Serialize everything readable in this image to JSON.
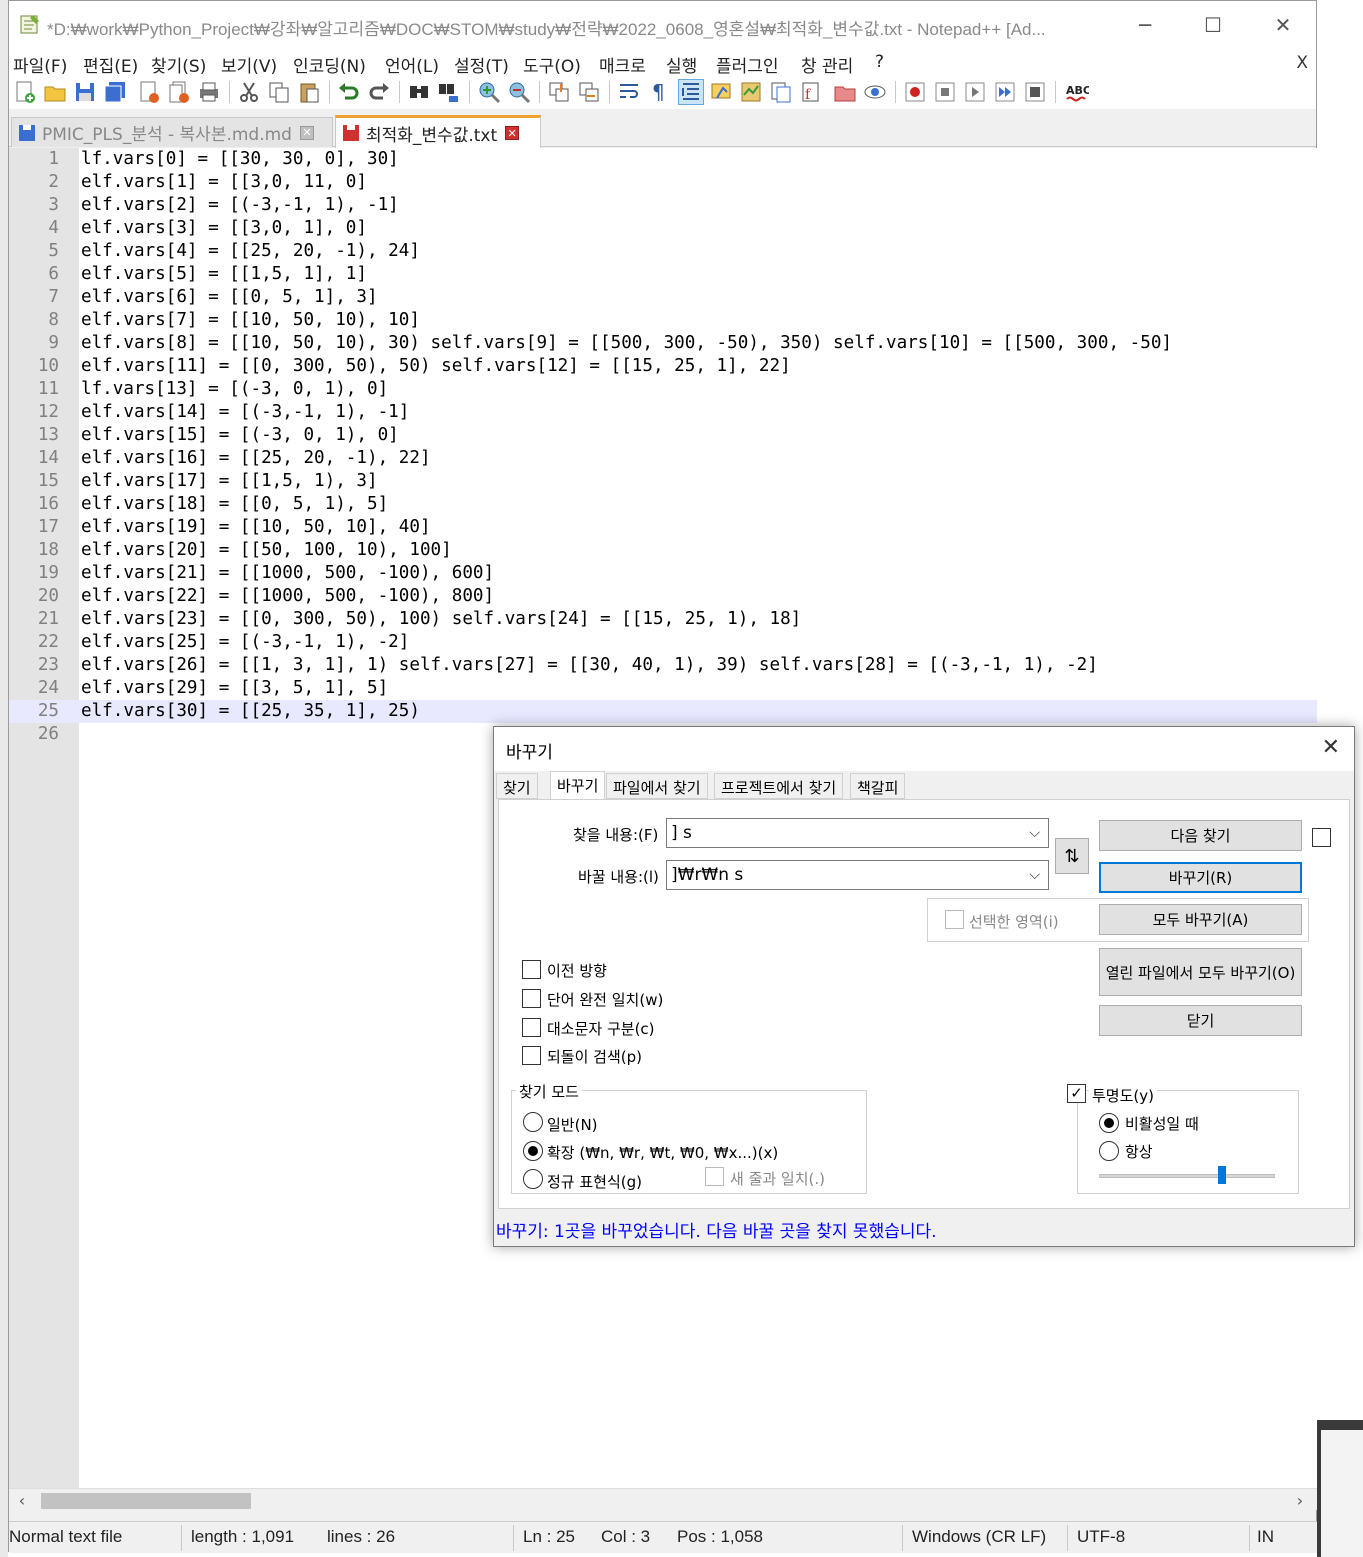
{
  "window": {
    "title": "*D:₩work₩Python_Project₩강좌₩알고리즘₩DOC₩STOM₩study₩전략₩2022_0608_영혼설₩최적화_변수값.txt - Notepad++ [Ad...",
    "minimize": "─",
    "maximize": "☐",
    "close": "✕"
  },
  "menu": {
    "items": [
      "파일(F)",
      "편집(E)",
      "찾기(S)",
      "보기(V)",
      "인코딩(N)",
      "언어(L)",
      "설정(T)",
      "도구(O)",
      "매크로",
      "실행",
      "플러그인",
      "창 관리",
      "?"
    ],
    "close": "X"
  },
  "tabs": [
    {
      "label": "PMIC_PLS_분석 - 복사본.md.md",
      "close": "✕"
    },
    {
      "label": "최적화_변수값.txt",
      "close": "✕"
    }
  ],
  "editor": {
    "lines": [
      {
        "n": "1",
        "text": "lf.vars[0] = [[30, 30, 0], 30]"
      },
      {
        "n": "2",
        "text": "elf.vars[1] = [[3,0, 11, 0]"
      },
      {
        "n": "3",
        "text": "elf.vars[2] = [(-3,-1, 1), -1]"
      },
      {
        "n": "4",
        "text": "elf.vars[3] = [[3,0, 1], 0]"
      },
      {
        "n": "5",
        "text": "elf.vars[4] = [[25, 20, -1), 24]"
      },
      {
        "n": "6",
        "text": "elf.vars[5] = [[1,5, 1], 1]"
      },
      {
        "n": "7",
        "text": "elf.vars[6] = [[0, 5, 1], 3]"
      },
      {
        "n": "8",
        "text": "elf.vars[7] = [[10, 50, 10), 10]"
      },
      {
        "n": "9",
        "text": "elf.vars[8] = [[10, 50, 10), 30) self.vars[9] = [[500, 300, -50), 350) self.vars[10] = [[500, 300, -50]"
      },
      {
        "n": "10",
        "text": "elf.vars[11] = [[0, 300, 50), 50) self.vars[12] = [[15, 25, 1], 22]"
      },
      {
        "n": "11",
        "text": "lf.vars[13] = [(-3, 0, 1), 0]"
      },
      {
        "n": "12",
        "text": "elf.vars[14] = [(-3,-1, 1), -1]"
      },
      {
        "n": "13",
        "text": "elf.vars[15] = [(-3, 0, 1), 0]"
      },
      {
        "n": "14",
        "text": "elf.vars[16] = [[25, 20, -1), 22]"
      },
      {
        "n": "15",
        "text": "elf.vars[17] = [[1,5, 1), 3]"
      },
      {
        "n": "16",
        "text": "elf.vars[18] = [[0, 5, 1), 5]"
      },
      {
        "n": "17",
        "text": "elf.vars[19] = [[10, 50, 10], 40]"
      },
      {
        "n": "18",
        "text": "elf.vars[20] = [[50, 100, 10), 100]"
      },
      {
        "n": "19",
        "text": "elf.vars[21] = [[1000, 500, -100), 600]"
      },
      {
        "n": "20",
        "text": "elf.vars[22] = [[1000, 500, -100), 800]"
      },
      {
        "n": "21",
        "text": "elf.vars[23] = [[0, 300, 50), 100) self.vars[24] = [[15, 25, 1), 18]"
      },
      {
        "n": "22",
        "text": "elf.vars[25] = [(-3,-1, 1), -2]"
      },
      {
        "n": "23",
        "text": "elf.vars[26] = [[1, 3, 1], 1) self.vars[27] = [[30, 40, 1), 39) self.vars[28] = [(-3,-1, 1), -2]"
      },
      {
        "n": "24",
        "text": "elf.vars[29] = [[3, 5, 1], 5]"
      },
      {
        "n": "25",
        "text": "elf.vars[30] = [[25, 35, 1], 25)"
      },
      {
        "n": "26",
        "text": ""
      }
    ],
    "current_line": "25"
  },
  "scroll": {
    "left": "‹",
    "right": "›"
  },
  "status": {
    "filetype": "Normal text file",
    "length": "length : 1,091",
    "lines": "lines : 26",
    "ln": "Ln : 25",
    "col": "Col : 3",
    "pos": "Pos : 1,058",
    "eol": "Windows (CR LF)",
    "encoding": "UTF-8",
    "mode": "IN"
  },
  "dialog": {
    "title": "바꾸기",
    "close": "✕",
    "tabs": [
      "찾기",
      "바꾸기",
      "파일에서 찾기",
      "프로젝트에서 찾기",
      "책갈피"
    ],
    "find_label": "찾을 내용:(F)",
    "find_value": "] s",
    "replace_label": "바꿀 내용:(l)",
    "replace_value": "]₩r₩n s",
    "swap": "⇅",
    "buttons": {
      "find_next": "다음 찾기",
      "replace": "바꾸기(R)",
      "replace_all": "모두 바꾸기(A)",
      "replace_all_open": "열린 파일에서 모두 바꾸기(O)",
      "close": "닫기"
    },
    "in_selection": "선택한 영역(i)",
    "options": {
      "backward": "이전 방향",
      "whole_word": "단어 완전 일치(w)",
      "match_case": "대소문자 구분(c)",
      "wrap": "되돌이 검색(p)"
    },
    "search_mode": {
      "title": "찾기 모드",
      "normal": "일반(N)",
      "extended": "확장 (₩n, ₩r, ₩t, ₩0, ₩x...)(x)",
      "regex": "정규 표현식(g)",
      "dot_newline": "새 줄과 일치(.)",
      "selected": "extended"
    },
    "transparency": {
      "label": "투명도(y)",
      "checked": true,
      "on_lose_focus": "비활성일 때",
      "always": "항상",
      "selected": "on_lose_focus",
      "level": 0.7
    },
    "status_message": "바꾸기: 1곳을 바꾸었습니다. 다음 바꿀 곳을 찾지 못했습니다."
  }
}
